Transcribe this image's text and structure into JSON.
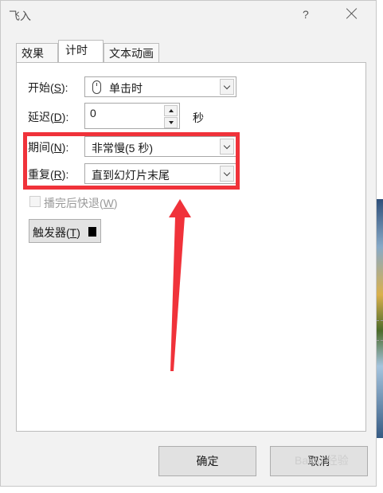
{
  "dialog": {
    "title": "飞入",
    "help": "?"
  },
  "tabs": [
    "效果",
    "计时",
    "文本动画"
  ],
  "active_tab": "计时",
  "timing": {
    "start_label": "开始(",
    "start_key": "S",
    "start_suffix": "):",
    "start_value": "单击时",
    "delay_label": "延迟(",
    "delay_key": "D",
    "delay_suffix": "):",
    "delay_value": "0",
    "delay_unit": "秒",
    "duration_label": "期间(",
    "duration_key": "N",
    "duration_suffix": "):",
    "duration_value": "非常慢(5 秒)",
    "repeat_label": "重复(",
    "repeat_key": "R",
    "repeat_suffix": "):",
    "repeat_value": "直到幻灯片末尾",
    "rewind_label": "播完后快退(",
    "rewind_key": "W",
    "rewind_suffix": ")",
    "trigger_label": "触发器(",
    "trigger_key": "T",
    "trigger_suffix": ")"
  },
  "buttons": {
    "ok": "确定",
    "cancel": "取消"
  },
  "colors": {
    "highlight": "#f0323a"
  },
  "watermark": "Baidu 经验"
}
